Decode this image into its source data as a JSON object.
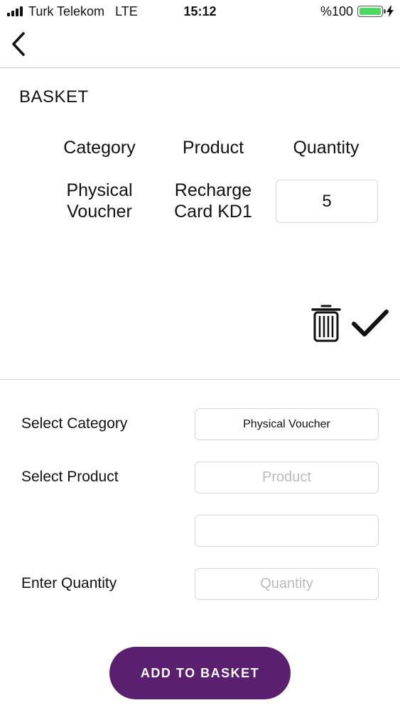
{
  "status_bar": {
    "carrier": "Turk Telekom",
    "network": "LTE",
    "time": "15:12",
    "battery_percent": "%100",
    "battery_color": "#4cd964"
  },
  "nav": {
    "back_icon": "chevron-left-icon"
  },
  "basket": {
    "title": "BASKET",
    "headers": {
      "category": "Category",
      "product": "Product",
      "quantity": "Quantity"
    },
    "rows": [
      {
        "category_line1": "Physical",
        "category_line2": "Voucher",
        "product_line1": "Recharge",
        "product_line2": "Card KD1",
        "quantity": "5"
      }
    ],
    "actions": {
      "delete_icon": "trash-icon",
      "confirm_icon": "checkmark-icon"
    }
  },
  "form": {
    "category_label": "Select Category",
    "category_value": "Physical Voucher",
    "product_label": "Select Product",
    "product_placeholder": "Product",
    "extra_value": "",
    "quantity_label": "Enter Quantity",
    "quantity_placeholder": "Quantity"
  },
  "add_button": {
    "label": "ADD TO BASKET",
    "color": "#5a1f6e"
  }
}
